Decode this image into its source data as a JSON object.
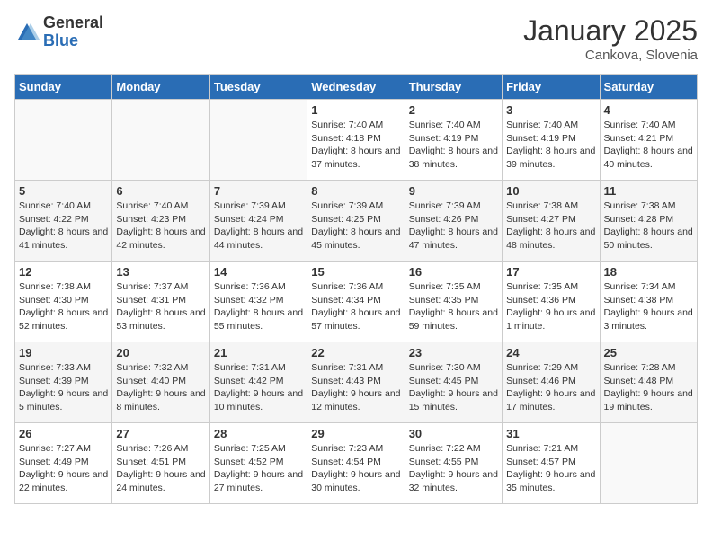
{
  "logo": {
    "general": "General",
    "blue": "Blue"
  },
  "title": "January 2025",
  "location": "Cankova, Slovenia",
  "days_of_week": [
    "Sunday",
    "Monday",
    "Tuesday",
    "Wednesday",
    "Thursday",
    "Friday",
    "Saturday"
  ],
  "weeks": [
    [
      {
        "day": "",
        "info": ""
      },
      {
        "day": "",
        "info": ""
      },
      {
        "day": "",
        "info": ""
      },
      {
        "day": "1",
        "info": "Sunrise: 7:40 AM\nSunset: 4:18 PM\nDaylight: 8 hours and 37 minutes."
      },
      {
        "day": "2",
        "info": "Sunrise: 7:40 AM\nSunset: 4:19 PM\nDaylight: 8 hours and 38 minutes."
      },
      {
        "day": "3",
        "info": "Sunrise: 7:40 AM\nSunset: 4:19 PM\nDaylight: 8 hours and 39 minutes."
      },
      {
        "day": "4",
        "info": "Sunrise: 7:40 AM\nSunset: 4:21 PM\nDaylight: 8 hours and 40 minutes."
      }
    ],
    [
      {
        "day": "5",
        "info": "Sunrise: 7:40 AM\nSunset: 4:22 PM\nDaylight: 8 hours and 41 minutes."
      },
      {
        "day": "6",
        "info": "Sunrise: 7:40 AM\nSunset: 4:23 PM\nDaylight: 8 hours and 42 minutes."
      },
      {
        "day": "7",
        "info": "Sunrise: 7:39 AM\nSunset: 4:24 PM\nDaylight: 8 hours and 44 minutes."
      },
      {
        "day": "8",
        "info": "Sunrise: 7:39 AM\nSunset: 4:25 PM\nDaylight: 8 hours and 45 minutes."
      },
      {
        "day": "9",
        "info": "Sunrise: 7:39 AM\nSunset: 4:26 PM\nDaylight: 8 hours and 47 minutes."
      },
      {
        "day": "10",
        "info": "Sunrise: 7:38 AM\nSunset: 4:27 PM\nDaylight: 8 hours and 48 minutes."
      },
      {
        "day": "11",
        "info": "Sunrise: 7:38 AM\nSunset: 4:28 PM\nDaylight: 8 hours and 50 minutes."
      }
    ],
    [
      {
        "day": "12",
        "info": "Sunrise: 7:38 AM\nSunset: 4:30 PM\nDaylight: 8 hours and 52 minutes."
      },
      {
        "day": "13",
        "info": "Sunrise: 7:37 AM\nSunset: 4:31 PM\nDaylight: 8 hours and 53 minutes."
      },
      {
        "day": "14",
        "info": "Sunrise: 7:36 AM\nSunset: 4:32 PM\nDaylight: 8 hours and 55 minutes."
      },
      {
        "day": "15",
        "info": "Sunrise: 7:36 AM\nSunset: 4:34 PM\nDaylight: 8 hours and 57 minutes."
      },
      {
        "day": "16",
        "info": "Sunrise: 7:35 AM\nSunset: 4:35 PM\nDaylight: 8 hours and 59 minutes."
      },
      {
        "day": "17",
        "info": "Sunrise: 7:35 AM\nSunset: 4:36 PM\nDaylight: 9 hours and 1 minute."
      },
      {
        "day": "18",
        "info": "Sunrise: 7:34 AM\nSunset: 4:38 PM\nDaylight: 9 hours and 3 minutes."
      }
    ],
    [
      {
        "day": "19",
        "info": "Sunrise: 7:33 AM\nSunset: 4:39 PM\nDaylight: 9 hours and 5 minutes."
      },
      {
        "day": "20",
        "info": "Sunrise: 7:32 AM\nSunset: 4:40 PM\nDaylight: 9 hours and 8 minutes."
      },
      {
        "day": "21",
        "info": "Sunrise: 7:31 AM\nSunset: 4:42 PM\nDaylight: 9 hours and 10 minutes."
      },
      {
        "day": "22",
        "info": "Sunrise: 7:31 AM\nSunset: 4:43 PM\nDaylight: 9 hours and 12 minutes."
      },
      {
        "day": "23",
        "info": "Sunrise: 7:30 AM\nSunset: 4:45 PM\nDaylight: 9 hours and 15 minutes."
      },
      {
        "day": "24",
        "info": "Sunrise: 7:29 AM\nSunset: 4:46 PM\nDaylight: 9 hours and 17 minutes."
      },
      {
        "day": "25",
        "info": "Sunrise: 7:28 AM\nSunset: 4:48 PM\nDaylight: 9 hours and 19 minutes."
      }
    ],
    [
      {
        "day": "26",
        "info": "Sunrise: 7:27 AM\nSunset: 4:49 PM\nDaylight: 9 hours and 22 minutes."
      },
      {
        "day": "27",
        "info": "Sunrise: 7:26 AM\nSunset: 4:51 PM\nDaylight: 9 hours and 24 minutes."
      },
      {
        "day": "28",
        "info": "Sunrise: 7:25 AM\nSunset: 4:52 PM\nDaylight: 9 hours and 27 minutes."
      },
      {
        "day": "29",
        "info": "Sunrise: 7:23 AM\nSunset: 4:54 PM\nDaylight: 9 hours and 30 minutes."
      },
      {
        "day": "30",
        "info": "Sunrise: 7:22 AM\nSunset: 4:55 PM\nDaylight: 9 hours and 32 minutes."
      },
      {
        "day": "31",
        "info": "Sunrise: 7:21 AM\nSunset: 4:57 PM\nDaylight: 9 hours and 35 minutes."
      },
      {
        "day": "",
        "info": ""
      }
    ]
  ]
}
